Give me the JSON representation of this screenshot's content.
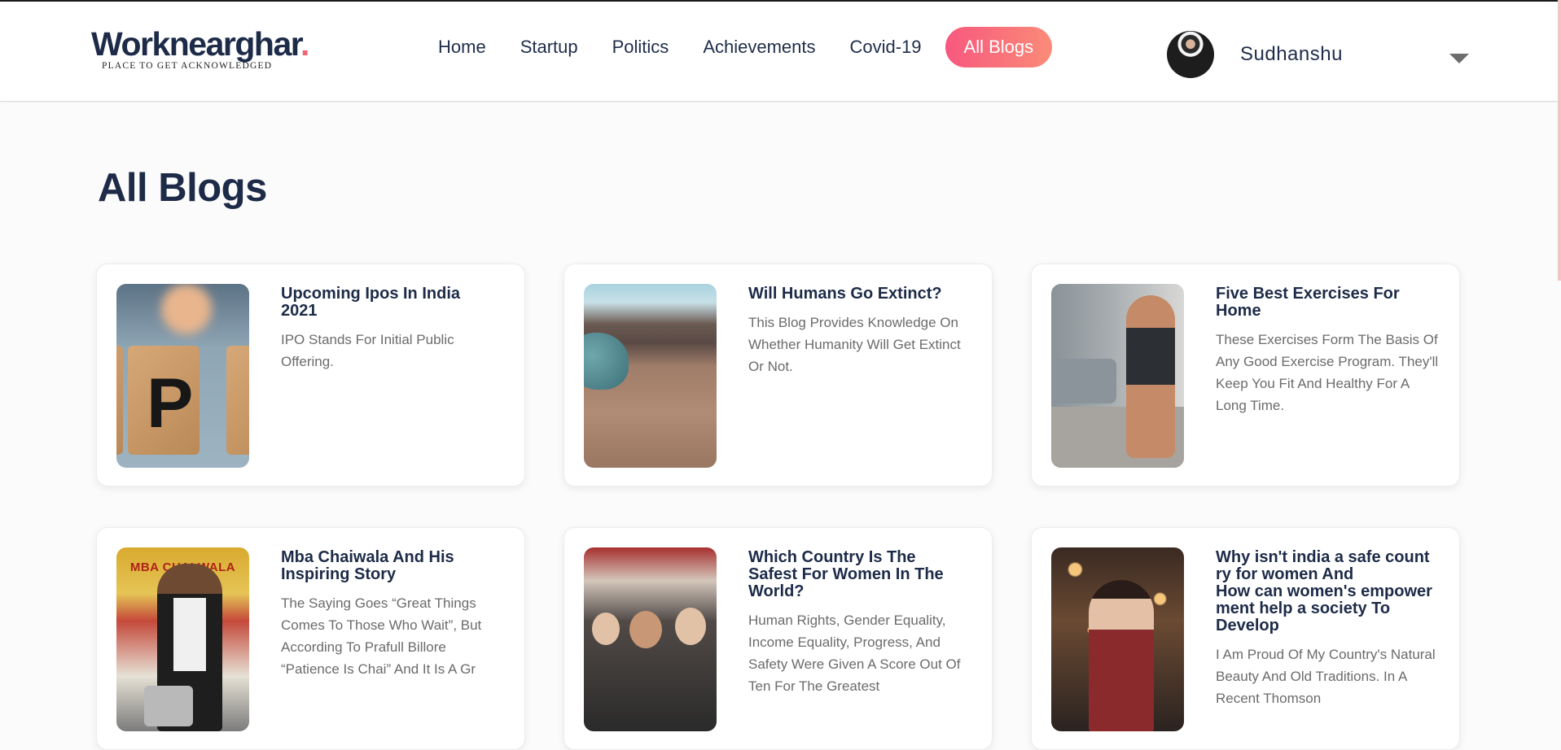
{
  "header": {
    "logo": {
      "name": "Worknearghar",
      "dot": ".",
      "tagline": "PLACE TO GET ACKNOWLEDGED"
    },
    "nav": {
      "home": "Home",
      "startup": "Startup",
      "politics": "Politics",
      "achievements": "Achievements",
      "covid": "Covid-19",
      "all_blogs": "All Blogs"
    },
    "user": {
      "name": "Sudhanshu",
      "avatar_icon": "user-avatar"
    },
    "accent_gradient": [
      "#f7587e",
      "#fb8b78"
    ]
  },
  "page": {
    "title": "All Blogs"
  },
  "blogs": [
    {
      "title": "Upcoming Ipos In India\n2021",
      "description": "IPO Stands For Initial Public Offering."
    },
    {
      "title": "Will Humans Go Extinct?",
      "description": "This Blog Provides Knowledge On Whether Humanity Will Get Extinct Or Not."
    },
    {
      "title": "Five Best Exercises For\nHome",
      "description": "These Exercises Form The Basis Of Any Good Exercise Program. They'll Keep You Fit And Healthy For A Long Time."
    },
    {
      "title": "Mba Chaiwala And His\nInspiring Story",
      "description": "The Saying Goes “Great Things Comes To Those Who Wait”, But According To Prafull Billore “Patience Is Chai” And It Is A Gr"
    },
    {
      "title": "Which Country Is The\nSafest For Women In The\nWorld?",
      "description": "Human Rights, Gender Equality, Income Equality, Progress, And Safety Were Given A Score Out Of Ten For The Greatest"
    },
    {
      "title": "Why isn't india a safe count\nry for women And\nHow can women's empower\nment help a society To\nDevelop",
      "description": "I Am Proud Of My Country's Natural Beauty And Old Traditions. In A Recent Thomson"
    }
  ],
  "thumb_text": {
    "mba_banner": "MBA CHAI WALA"
  }
}
